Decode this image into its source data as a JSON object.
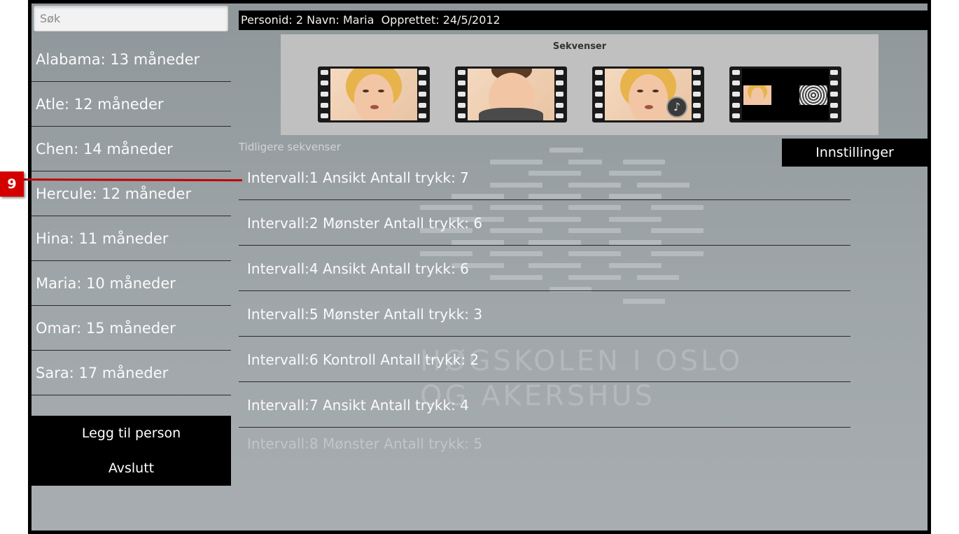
{
  "sidebar": {
    "search_placeholder": "Søk",
    "people": [
      {
        "label": "Alabama: 13 måneder"
      },
      {
        "label": "Atle: 12 måneder"
      },
      {
        "label": "Chen: 14 måneder"
      },
      {
        "label": "Hercule: 12 måneder"
      },
      {
        "label": "Hina: 11 måneder"
      },
      {
        "label": "Maria: 10 måneder"
      },
      {
        "label": "Omar: 15 måneder"
      },
      {
        "label": "Sara: 17 måneder"
      }
    ],
    "add_person_label": "Legg til person",
    "exit_label": "Avslutt"
  },
  "header": {
    "info_text": "Personid: 2 Navn: Maria  Opprettet: 24/5/2012"
  },
  "sequences": {
    "title": "Sekvenser",
    "thumbnails": [
      {
        "kind": "face"
      },
      {
        "kind": "hidden-face"
      },
      {
        "kind": "face-with-sound",
        "icon": "music-note-icon"
      },
      {
        "kind": "face-and-pattern"
      }
    ]
  },
  "history": {
    "label": "Tidligere sekvenser",
    "settings_label": "Innstillinger",
    "intervals": [
      {
        "label": "Intervall:1 Ansikt Antall trykk: 7"
      },
      {
        "label": "Intervall:2 Mønster Antall trykk: 6"
      },
      {
        "label": "Intervall:4 Ansikt Antall trykk: 6"
      },
      {
        "label": "Intervall:5 Mønster Antall trykk: 3"
      },
      {
        "label": "Intervall:6 Kontroll Antall trykk: 2"
      },
      {
        "label": "Intervall:7 Ansikt Antall trykk: 4"
      },
      {
        "label": "Intervall:8 Mønster Antall trykk: 5"
      }
    ]
  },
  "watermark": {
    "line1": "HØGSKOLEN I OSLO",
    "line2": "OG AKERSHUS"
  },
  "annotation": {
    "number": "9",
    "color": "#d40000"
  }
}
